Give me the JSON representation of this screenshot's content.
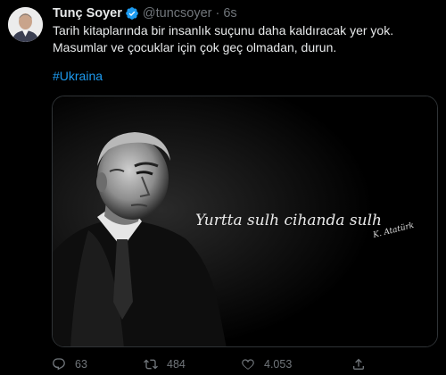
{
  "tweet": {
    "author": {
      "display_name": "Tunç Soyer",
      "handle": "@tuncsoyer",
      "verified": true
    },
    "separator": "·",
    "time": "6s",
    "text": "Tarih kitaplarında bir insanlık suçunu daha kaldıracak yer yok. Masumlar ve çocuklar için çok geç olmadan, durun.",
    "hashtag": "#Ukraina",
    "media": {
      "quote": "Yurtta sulh cihanda sulh",
      "signature": "K. Atatürk"
    },
    "stats": {
      "replies": "63",
      "retweets": "484",
      "likes": "4.053"
    }
  },
  "colors": {
    "background": "#000000",
    "text": "#e7e9ea",
    "muted": "#71767b",
    "accent": "#1d9bf0",
    "border": "#2f3336"
  },
  "icons": {
    "verified": "verified-badge-icon",
    "reply": "reply-icon",
    "retweet": "retweet-icon",
    "like": "heart-icon",
    "share": "share-icon"
  }
}
